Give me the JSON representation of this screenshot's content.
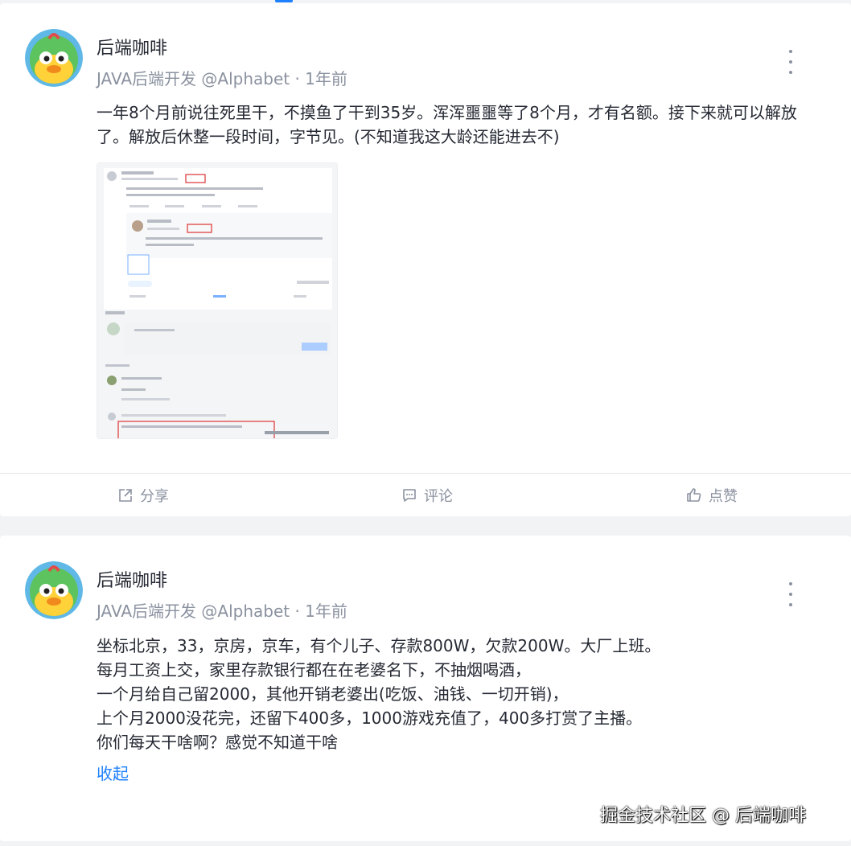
{
  "colors": {
    "accent": "#1e80ff",
    "meta": "#8a919f",
    "text": "#252933"
  },
  "posts": [
    {
      "author": "后端咖啡",
      "meta_line": "JAVA后端开发 @Alphabet · 1年前",
      "content_lines": [
        "一年8个月前说往死里干，不摸鱼了干到35岁。浑浑噩噩等了8个月，才有名额。接下来就可以解放",
        "了。解放后休整一段时间，字节见。(不知道我这大龄还能进去不)"
      ],
      "image_icon": "screenshot-thumbnail",
      "actions": {
        "share": "分享",
        "comment": "评论",
        "like": "点赞"
      }
    },
    {
      "author": "后端咖啡",
      "meta_line": "JAVA后端开发 @Alphabet · 1年前",
      "content_lines": [
        "坐标北京，33，京房，京车，有个儿子、存款800W，欠款200W。大厂上班。",
        "每月工资上交，家里存款银行都在在老婆名下，不抽烟喝酒，",
        "一个月给自己留2000，其他开销老婆出(吃饭、油钱、一切开销)，",
        "上个月2000没花完，还留下400多，1000游戏充值了，400多打赏了主播。",
        "你们每天干啥啊？感觉不知道干啥"
      ],
      "collapse": "收起",
      "watermark": "掘金技术社区 @ 后端咖啡"
    }
  ]
}
